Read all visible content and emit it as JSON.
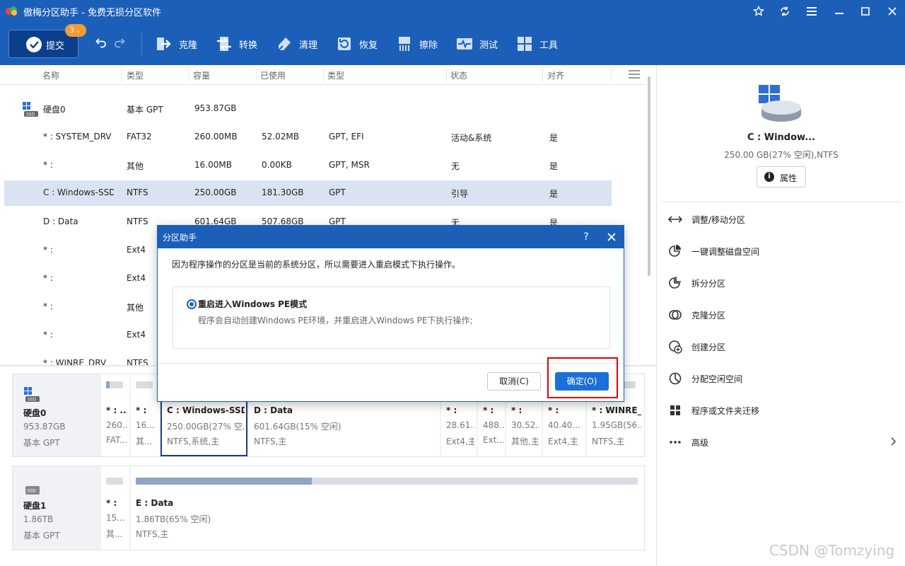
{
  "app": {
    "title": "傲梅分区助手 - 免费无损分区软件"
  },
  "toolbar": {
    "commit_label": "提交",
    "pending_count": "3",
    "tools": [
      {
        "label": "克隆",
        "icon": "clone-icon"
      },
      {
        "label": "转换",
        "icon": "convert-icon"
      },
      {
        "label": "清理",
        "icon": "clean-icon"
      },
      {
        "label": "恢复",
        "icon": "recover-icon"
      },
      {
        "label": "擦除",
        "icon": "wipe-icon"
      },
      {
        "label": "测试",
        "icon": "test-icon"
      },
      {
        "label": "工具",
        "icon": "tools-icon"
      }
    ]
  },
  "table": {
    "columns": [
      "名称",
      "类型",
      "容量",
      "已使用",
      "类型",
      "状态",
      "对齐"
    ],
    "rows": [
      {
        "name": "硬盘0",
        "type": "基本 GPT",
        "capacity": "953.87GB",
        "used": "",
        "ptype": "",
        "status": "",
        "align": ""
      },
      {
        "name": "* : SYSTEM_DRV",
        "type": "FAT32",
        "capacity": "260.00MB",
        "used": "52.02MB",
        "ptype": "GPT, EFI",
        "status": "活动&系统",
        "align": "是"
      },
      {
        "name": "* :",
        "type": "其他",
        "capacity": "16.00MB",
        "used": "0.00KB",
        "ptype": "GPT, MSR",
        "status": "无",
        "align": "是"
      },
      {
        "name": "C : Windows-SSD",
        "type": "NTFS",
        "capacity": "250.00GB",
        "used": "181.30GB",
        "ptype": "GPT",
        "status": "引导",
        "align": "是"
      },
      {
        "name": "D : Data",
        "type": "NTFS",
        "capacity": "601.64GB",
        "used": "507.68GB",
        "ptype": "GPT",
        "status": "无",
        "align": "是"
      },
      {
        "name": "* :",
        "type": "Ext4",
        "capacity": "",
        "used": "",
        "ptype": "",
        "status": "",
        "align": ""
      },
      {
        "name": "* :",
        "type": "Ext4",
        "capacity": "",
        "used": "",
        "ptype": "",
        "status": "",
        "align": ""
      },
      {
        "name": "* :",
        "type": "其他",
        "capacity": "",
        "used": "",
        "ptype": "",
        "status": "",
        "align": ""
      },
      {
        "name": "* :",
        "type": "Ext4",
        "capacity": "",
        "used": "",
        "ptype": "",
        "status": "",
        "align": ""
      },
      {
        "name": "* : WINRE_DRV",
        "type": "NTFS",
        "capacity": "",
        "used": "",
        "ptype": "",
        "status": "",
        "align": ""
      }
    ]
  },
  "disk0": {
    "name": "硬盘0",
    "size": "953.87GB",
    "style": "基本 GPT",
    "parts": [
      {
        "name": "* : ...",
        "size": "260...",
        "fs": "FAT...",
        "usage": 0.2
      },
      {
        "name": "* :",
        "size": "16...",
        "fs": "其...",
        "usage": 0.0
      },
      {
        "name": "C : Windows-SSD",
        "size": "250.00GB(27% 空...",
        "fs": "NTFS,系统,主",
        "usage": 0.73
      },
      {
        "name": "D : Data",
        "size": "601.64GB(15% 空闲)",
        "fs": "NTFS,主",
        "usage": 0.85
      },
      {
        "name": "* :",
        "size": "28.61...",
        "fs": "Ext4,主",
        "usage": 0.5
      },
      {
        "name": "* :",
        "size": "488...",
        "fs": "Ext...",
        "usage": 0.5
      },
      {
        "name": "* :",
        "size": "30.52...",
        "fs": "其他,主",
        "usage": 0.5
      },
      {
        "name": "* :",
        "size": "40.40...",
        "fs": "Ext4,主",
        "usage": 0.5
      },
      {
        "name": "* : WINRE_...",
        "size": "1.95GB(56...",
        "fs": "NTFS,主",
        "usage": 0.44
      }
    ]
  },
  "disk1": {
    "name": "硬盘1",
    "size": "1.86TB",
    "style": "基本 GPT",
    "parts": [
      {
        "name": "* :",
        "size": "15...",
        "fs": "其...",
        "usage": 0.0
      },
      {
        "name": "E : Data",
        "size": "1.86TB(65% 空闲)",
        "fs": "NTFS,主",
        "usage": 0.35
      }
    ]
  },
  "right_panel": {
    "name": "C : Window...",
    "info": "250.00 GB(27% 空闲),NTFS",
    "properties_label": "属性",
    "ops": [
      {
        "label": "调整/移动分区",
        "icon": "resize-icon"
      },
      {
        "label": "一键调整磁盘空间",
        "icon": "pie-adjust-icon"
      },
      {
        "label": "拆分分区",
        "icon": "split-icon"
      },
      {
        "label": "克隆分区",
        "icon": "clone-partition-icon"
      },
      {
        "label": "创建分区",
        "icon": "create-partition-icon"
      },
      {
        "label": "分配空闲空间",
        "icon": "allocate-icon"
      },
      {
        "label": "程序或文件夹迁移",
        "icon": "migrate-icon"
      },
      {
        "label": "高级",
        "icon": "more-icon"
      }
    ]
  },
  "dialog": {
    "title": "分区助手",
    "help": "?",
    "message": "因为程序操作的分区是当前的系统分区，所以需要进入重启模式下执行操作。",
    "option_label": "重启进入Windows PE模式",
    "option_desc": "程序会自动创建Windows PE环境，并重启进入Windows PE下执行操作;",
    "cancel_label": "取消(C)",
    "ok_label": "确定(O)"
  },
  "watermark": "CSDN @Tomzying",
  "colors": {
    "brand_blue": "#1c5fb8",
    "selected_row": "#d9e3f2",
    "highlight_red": "#e60000",
    "badge_orange": "#f39c33"
  }
}
